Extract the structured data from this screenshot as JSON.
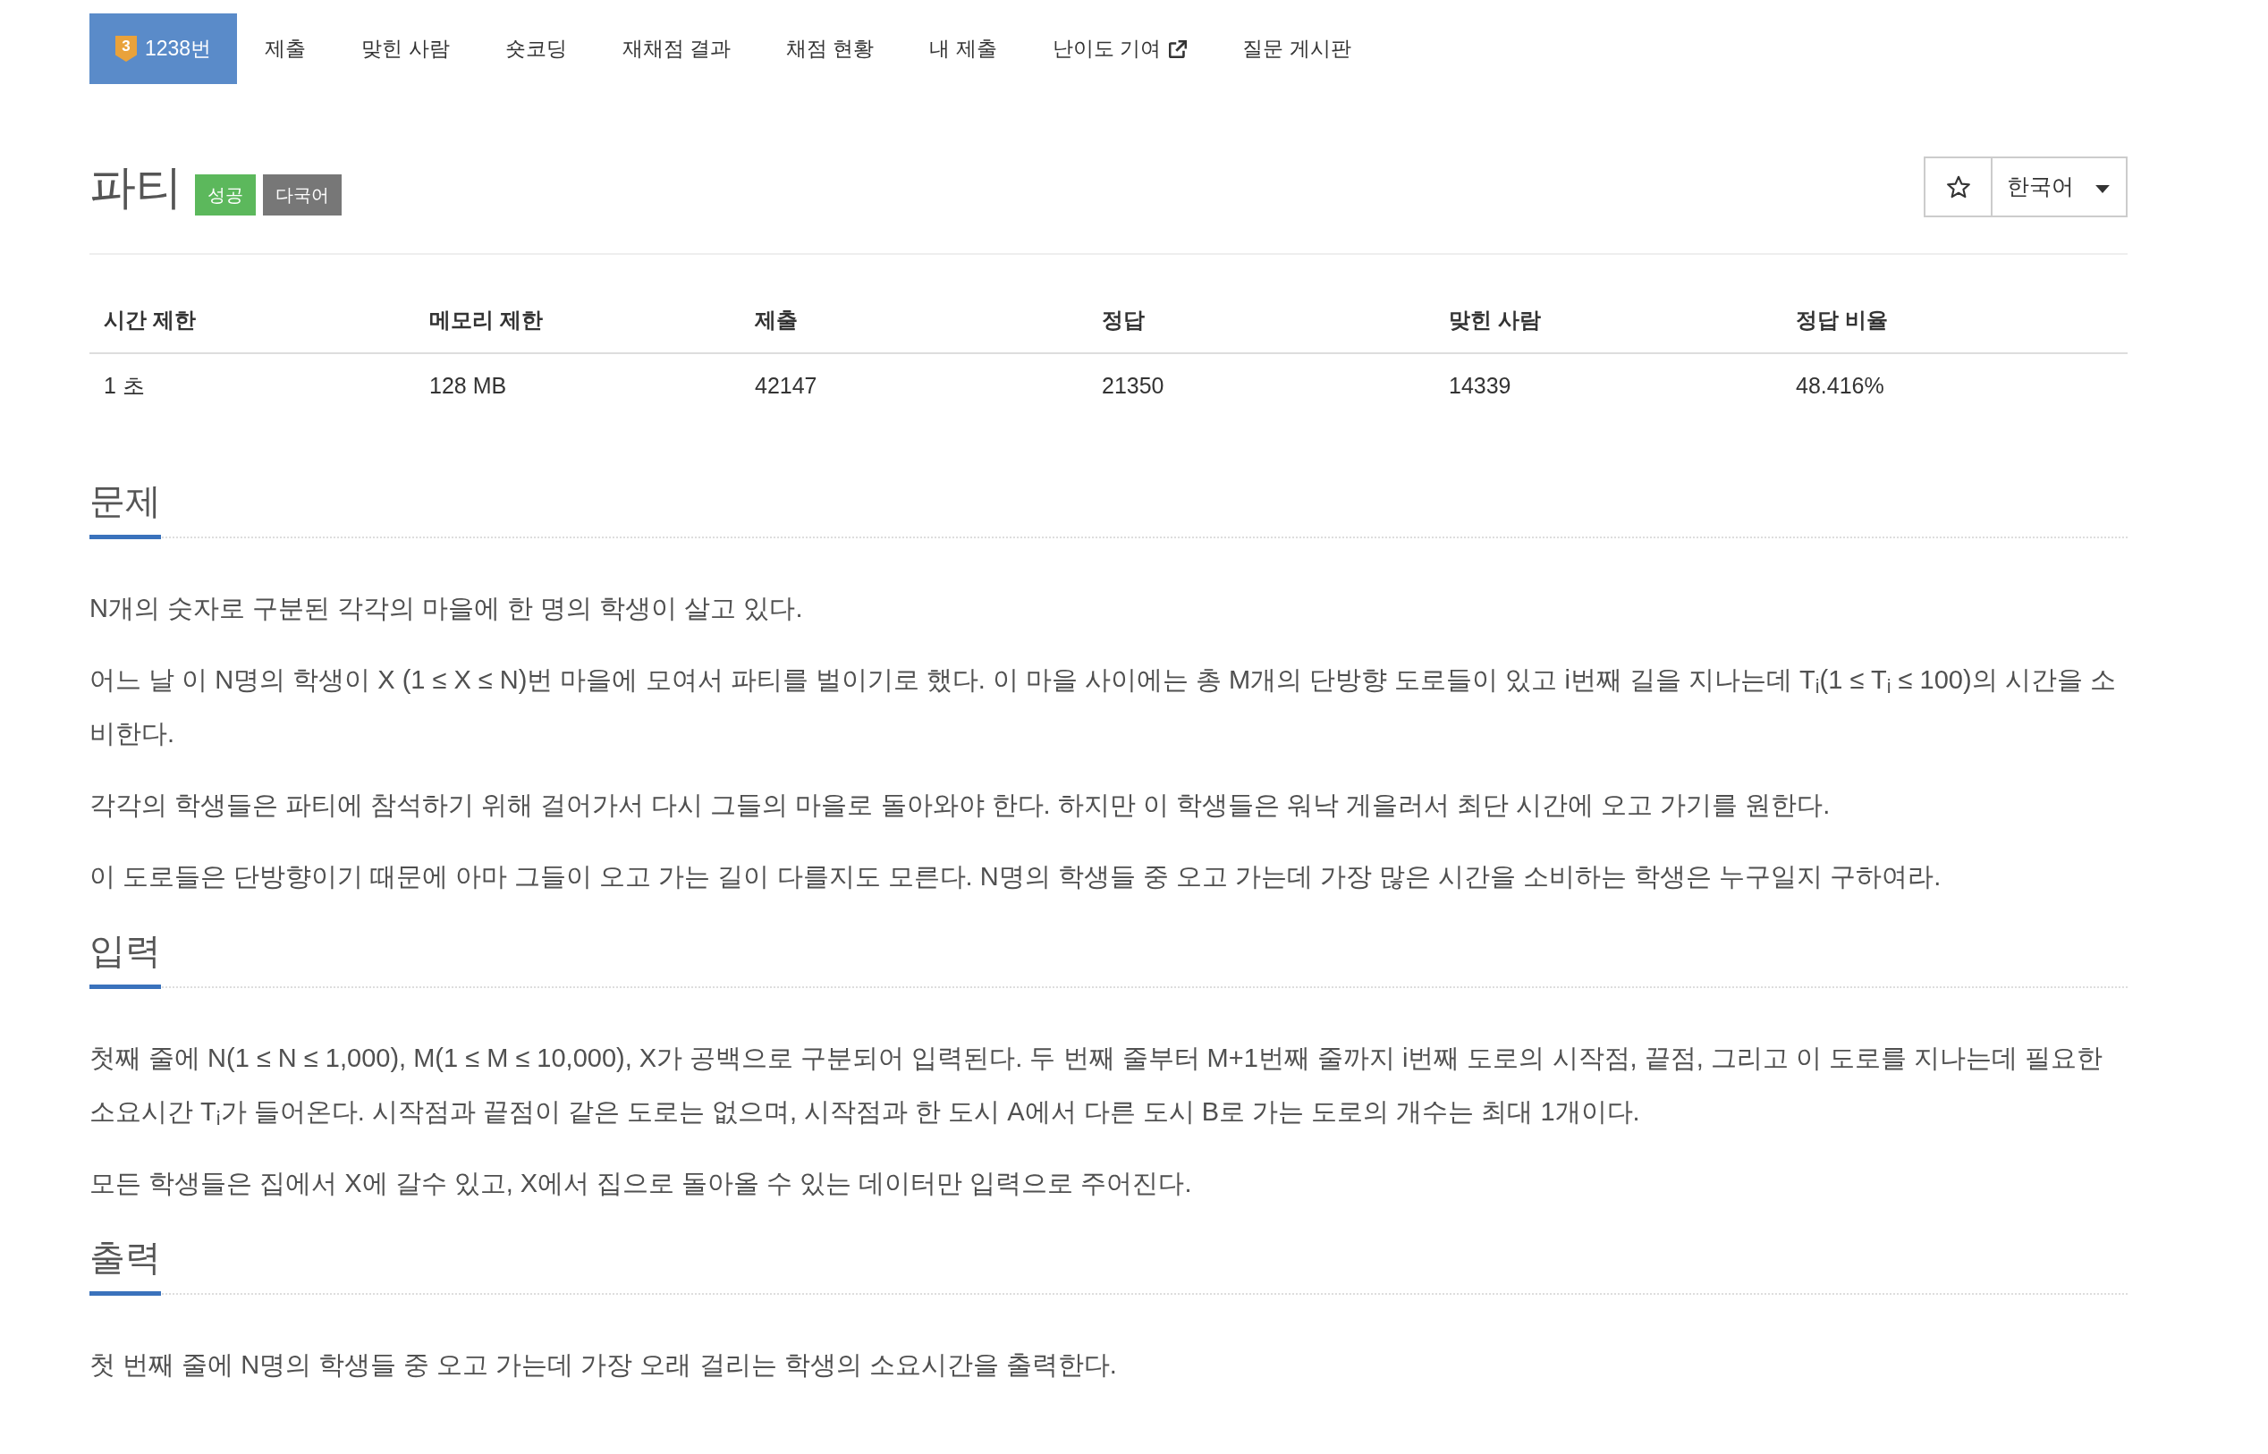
{
  "nav": {
    "items": [
      {
        "label": "1238번",
        "tier": "3",
        "selected": true,
        "external": false
      },
      {
        "label": "제출",
        "selected": false,
        "external": false
      },
      {
        "label": "맞힌 사람",
        "selected": false,
        "external": false
      },
      {
        "label": "숏코딩",
        "selected": false,
        "external": false
      },
      {
        "label": "재채점 결과",
        "selected": false,
        "external": false
      },
      {
        "label": "채점 현황",
        "selected": false,
        "external": false
      },
      {
        "label": "내 제출",
        "selected": false,
        "external": false
      },
      {
        "label": "난이도 기여",
        "selected": false,
        "external": true
      },
      {
        "label": "질문 게시판",
        "selected": false,
        "external": false
      }
    ]
  },
  "problem": {
    "title": "파티",
    "badges": [
      {
        "label": "성공",
        "color": "#5cb85c"
      },
      {
        "label": "다국어",
        "color": "#777777"
      }
    ],
    "language": "한국어"
  },
  "stats_table": {
    "columns": [
      "시간 제한",
      "메모리 제한",
      "제출",
      "정답",
      "맞힌 사람",
      "정답 비율"
    ],
    "rows": [
      [
        "1 초",
        "128 MB",
        "42147",
        "21350",
        "14339",
        "48.416%"
      ]
    ]
  },
  "sections": [
    {
      "heading": "문제",
      "paragraphs": [
        "N개의 숫자로 구분된 각각의 마을에 한 명의 학생이 살고 있다.",
        "어느 날 이 N명의 학생이 X (1 ≤ X ≤ N)번 마을에 모여서 파티를 벌이기로 했다. 이 마을 사이에는 총 M개의 단방향 도로들이 있고 i번째 길을 지나는데 T$_{i}$(1 ≤ T$_{i}$ ≤ 100)의 시간을 소비한다.",
        "각각의 학생들은 파티에 참석하기 위해 걸어가서 다시 그들의 마을로 돌아와야 한다. 하지만 이 학생들은 워낙 게을러서 최단 시간에 오고 가기를 원한다.",
        "이 도로들은 단방향이기 때문에 아마 그들이 오고 가는 길이 다를지도 모른다. N명의 학생들 중 오고 가는데 가장 많은 시간을 소비하는 학생은 누구일지 구하여라."
      ]
    },
    {
      "heading": "입력",
      "paragraphs": [
        "첫째 줄에 N(1 ≤ N ≤ 1,000), M(1 ≤ M ≤ 10,000), X가 공백으로 구분되어 입력된다. 두 번째 줄부터 M+1번째 줄까지 i번째 도로의 시작점, 끝점, 그리고 이 도로를 지나는데 필요한 소요시간 T$_{i}$가 들어온다. 시작점과 끝점이 같은 도로는 없으며, 시작점과 한 도시 A에서 다른 도시 B로 가는 도로의 개수는 최대 1개이다.",
        "모든 학생들은 집에서 X에 갈수 있고, X에서 집으로 돌아올 수 있는 데이터만 입력으로 주어진다."
      ]
    },
    {
      "heading": "출력",
      "paragraphs": [
        "첫 번째 줄에 N명의 학생들 중 오고 가는데 가장 오래 걸리는 학생의 소요시간을 출력한다."
      ]
    }
  ]
}
